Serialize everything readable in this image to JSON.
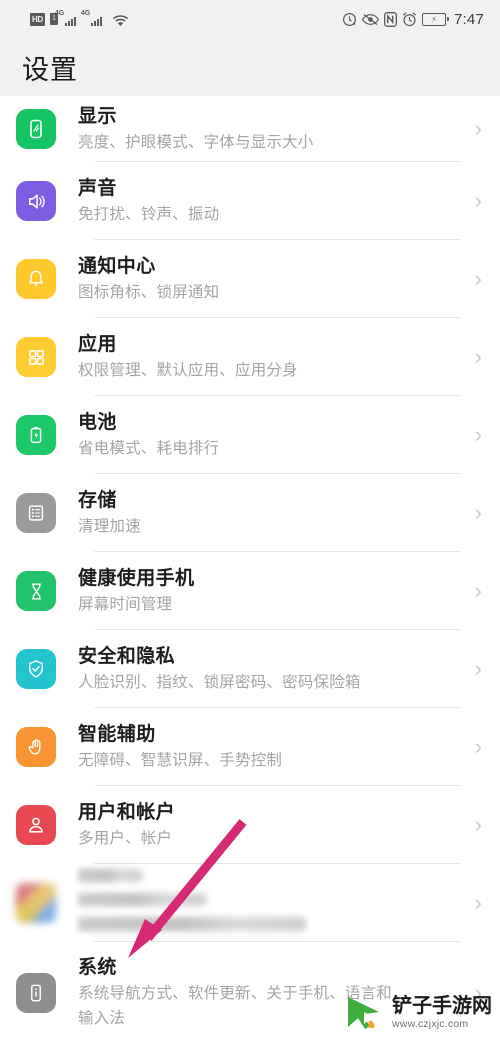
{
  "status_bar": {
    "left_icons": [
      "hd-icon",
      "sim-icon",
      "signal-4g-icon",
      "signal-4g-icon",
      "wifi-icon"
    ],
    "hd_label": "HD",
    "sim_label": "1",
    "network_label_1": "4G",
    "network_label_2": "4G",
    "right_icons": [
      "sync-icon",
      "eye-comfort-icon",
      "nfc-icon",
      "alarm-icon",
      "battery-charging-icon"
    ],
    "nfc_label": "N",
    "time": "7:47"
  },
  "header": {
    "title": "设置"
  },
  "list": [
    {
      "id": "display",
      "title": "显示",
      "subtitle": "亮度、护眼模式、字体与显示大小",
      "icon": "display-icon",
      "icon_color": "#16c464",
      "chevron": "›"
    },
    {
      "id": "sound",
      "title": "声音",
      "subtitle": "免打扰、铃声、振动",
      "icon": "sound-icon",
      "icon_color": "#7c5ce0",
      "chevron": "›"
    },
    {
      "id": "notification-center",
      "title": "通知中心",
      "subtitle": "图标角标、锁屏通知",
      "icon": "bell-icon",
      "icon_color": "#ffc82c",
      "chevron": "›"
    },
    {
      "id": "apps",
      "title": "应用",
      "subtitle": "权限管理、默认应用、应用分身",
      "icon": "apps-grid-icon",
      "icon_color": "#ffcc33",
      "chevron": "›"
    },
    {
      "id": "battery",
      "title": "电池",
      "subtitle": "省电模式、耗电排行",
      "icon": "battery-icon",
      "icon_color": "#1ec96a",
      "chevron": "›"
    },
    {
      "id": "storage",
      "title": "存储",
      "subtitle": "清理加速",
      "icon": "storage-icon",
      "icon_color": "#9a9a9a",
      "chevron": "›"
    },
    {
      "id": "digital-balance",
      "title": "健康使用手机",
      "subtitle": "屏幕时间管理",
      "icon": "hourglass-icon",
      "icon_color": "#22c46b",
      "chevron": "›"
    },
    {
      "id": "security-privacy",
      "title": "安全和隐私",
      "subtitle": "人脸识别、指纹、锁屏密码、密码保险箱",
      "icon": "shield-check-icon",
      "icon_color": "#23c4d0",
      "chevron": "›"
    },
    {
      "id": "smart-assistance",
      "title": "智能辅助",
      "subtitle": "无障碍、智慧识屏、手势控制",
      "icon": "hand-icon",
      "icon_color": "#f79433",
      "chevron": "›"
    },
    {
      "id": "users-accounts",
      "title": "用户和帐户",
      "subtitle": "多用户、帐户",
      "icon": "user-icon",
      "icon_color": "#e8484f",
      "chevron": "›"
    }
  ],
  "blurred_row": {
    "id": "blurred-entry",
    "icon": "multicolor-app-icon",
    "title": "",
    "subtitle": "",
    "chevron": "›"
  },
  "system_row": {
    "id": "system",
    "title": "系统",
    "subtitle_line1": "系统导航方式、软件更新、关于手机、语言和",
    "subtitle_line2": "输入法",
    "icon": "system-phone-icon",
    "icon_color": "#8e8e8e",
    "chevron": "›"
  },
  "annotation": {
    "arrow_color": "#d62976",
    "arrow_name": "pink-pointer-arrow",
    "target": "系统"
  },
  "watermark": {
    "logo": "green-cursor-logo",
    "site_name": "铲子手游网",
    "url": "www.czjxjc.com"
  }
}
